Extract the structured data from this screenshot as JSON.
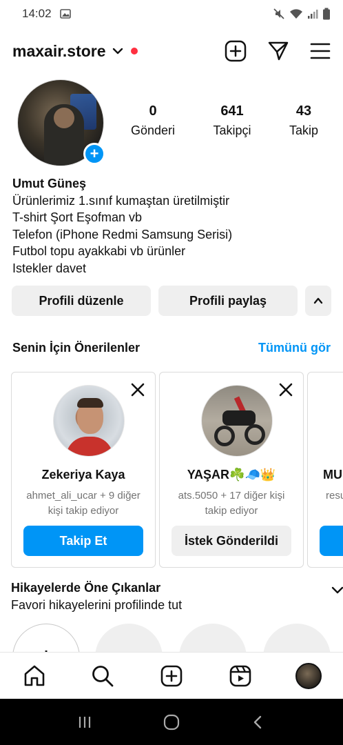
{
  "status_bar": {
    "time": "14:02"
  },
  "header": {
    "username": "maxair.store"
  },
  "profile": {
    "stats": [
      {
        "value": "0",
        "label": "Gönderi"
      },
      {
        "value": "641",
        "label": "Takipçi"
      },
      {
        "value": "43",
        "label": "Takip"
      }
    ],
    "bio": {
      "name": "Umut Güneş",
      "lines": [
        "Ürünlerimiz 1.sınıf kumaştan üretilmiştir",
        "T-shirt Şort Eşofman vb",
        "Telefon (iPhone Redmi Samsung Serisi)",
        "Futbol topu ayakkabi vb ürünler",
        "Istekler davet"
      ]
    },
    "buttons": {
      "edit": "Profili düzenle",
      "share": "Profili paylaş"
    }
  },
  "suggestions": {
    "title": "Senin İçin Önerilenler",
    "see_all": "Tümünü gör",
    "cards": [
      {
        "name": "Zekeriya Kaya",
        "subtitle": "ahmet_ali_ucar + 9 diğer kişi takip ediyor",
        "button": "Takip Et"
      },
      {
        "name": "YAŞAR☘️🧢👑",
        "subtitle": "ats.5050 + 17 diğer kişi takip ediyor",
        "button": "İstek Gönderildi"
      },
      {
        "name": "MU",
        "subtitle": "resu k",
        "button": ""
      }
    ]
  },
  "highlights": {
    "title": "Hikayelerde Öne Çıkanlar",
    "subtitle": "Favori hikayelerini profilinde tut",
    "new_symbol": "+"
  },
  "colors": {
    "accent": "#0095f6",
    "notification": "#ff3040",
    "button_bg": "#efefef"
  }
}
